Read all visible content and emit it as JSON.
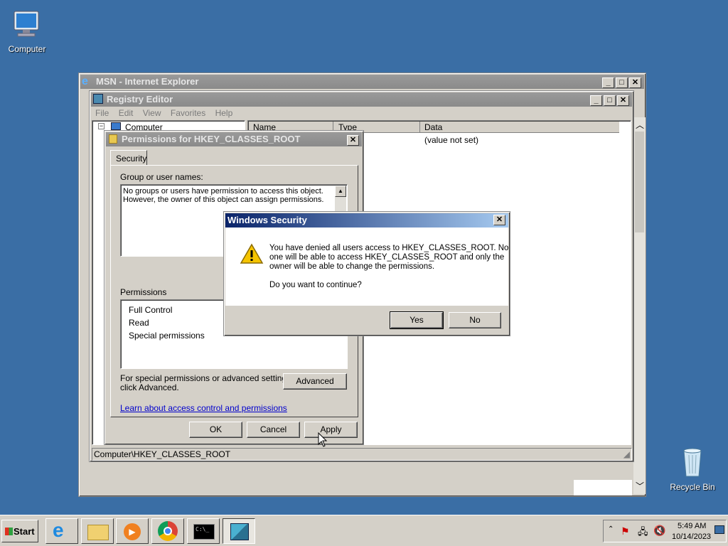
{
  "desktop": {
    "computer_label": "Computer",
    "recycle_label": "Recycle Bin"
  },
  "ie": {
    "title": "MSN - Internet Explorer"
  },
  "regedit": {
    "title": "Registry Editor",
    "menu": [
      "File",
      "Edit",
      "View",
      "Favorites",
      "Help"
    ],
    "tree_root": "Computer",
    "columns": {
      "name": "Name",
      "type": "Type",
      "data": "Data"
    },
    "row_data": "(value not set)",
    "status": "Computer\\HKEY_CLASSES_ROOT"
  },
  "perms": {
    "title": "Permissions for HKEY_CLASSES_ROOT",
    "tab": "Security",
    "group_label": "Group or user names:",
    "group_text_1": "No groups or users have permission to access this object.",
    "group_text_2": "However, the owner of this object can assign permissions.",
    "permissions_label": "Permissions",
    "items": [
      "Full Control",
      "Read",
      "Special permissions"
    ],
    "special_text_1": "For special permissions or advanced settings,",
    "special_text_2": "click Advanced.",
    "advanced": "Advanced",
    "link": "Learn about access control and permissions",
    "ok": "OK",
    "cancel": "Cancel",
    "apply": "Apply"
  },
  "security": {
    "title": "Windows Security",
    "msg_1": "You have denied all users access to HKEY_CLASSES_ROOT. No",
    "msg_2": "one will be able to access HKEY_CLASSES_ROOT and only the",
    "msg_3": "owner will be able to change the permissions.",
    "question": "Do you want to continue?",
    "yes": "Yes",
    "no": "No"
  },
  "taskbar": {
    "start": "Start",
    "time": "5:49 AM",
    "date": "10/14/2023"
  }
}
